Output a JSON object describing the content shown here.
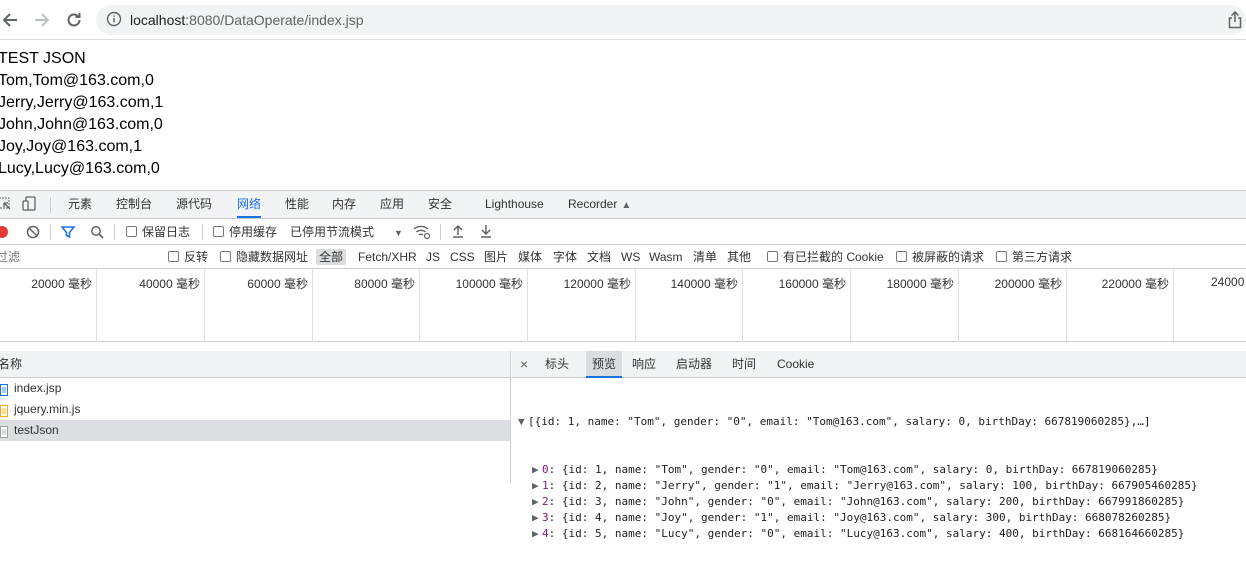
{
  "browser": {
    "url_host": "localhost",
    "url_rest": ":8080/DataOperate/index.jsp"
  },
  "page": {
    "lines": [
      "TEST JSON",
      "Tom,Tom@163.com,0",
      "Jerry,Jerry@163.com,1",
      "John,John@163.com,0",
      "Joy,Joy@163.com,1",
      "Lucy,Lucy@163.com,0"
    ]
  },
  "devtools": {
    "tabs": [
      "元素",
      "控制台",
      "源代码",
      "网络",
      "性能",
      "内存",
      "应用",
      "安全",
      "Lighthouse",
      "Recorder"
    ],
    "active_tab": "网络",
    "toolbar": {
      "preserve_log": "保留日志",
      "disable_cache": "停用缓存",
      "throttle": "已停用节流模式"
    },
    "filter": {
      "placeholder": "过滤",
      "invert": "反转",
      "hide_data_urls": "隐藏数据网址",
      "types": [
        "全部",
        "Fetch/XHR",
        "JS",
        "CSS",
        "图片",
        "媒体",
        "字体",
        "文档",
        "WS",
        "Wasm",
        "清单",
        "其他"
      ],
      "blocked_cookies": "有已拦截的 Cookie",
      "blocked_requests": "被屏蔽的请求",
      "third_party": "第三方请求"
    },
    "timeline": {
      "labels": [
        "20000 毫秒",
        "40000 毫秒",
        "60000 毫秒",
        "80000 毫秒",
        "100000 毫秒",
        "120000 毫秒",
        "140000 毫秒",
        "160000 毫秒",
        "180000 毫秒",
        "200000 毫秒",
        "220000 毫秒",
        "24000"
      ]
    },
    "requests": {
      "header": "名称",
      "items": [
        "index.jsp",
        "jquery.min.js",
        "testJson"
      ],
      "selected": "testJson"
    },
    "detail": {
      "close": "×",
      "tabs": [
        "标头",
        "预览",
        "响应",
        "启动器",
        "时间",
        "Cookie"
      ],
      "active_tab": "预览",
      "json_summary": "[{id: 1, name: \"Tom\", gender: \"0\", email: \"Tom@163.com\", salary: 0, birthDay: 667819060285},…]",
      "json_rows": [
        {
          "index": "0",
          "text": "{id: 1, name: \"Tom\", gender: \"0\", email: \"Tom@163.com\", salary: 0, birthDay: 667819060285}"
        },
        {
          "index": "1",
          "text": "{id: 2, name: \"Jerry\", gender: \"1\", email: \"Jerry@163.com\", salary: 100, birthDay: 667905460285}"
        },
        {
          "index": "2",
          "text": "{id: 3, name: \"John\", gender: \"0\", email: \"John@163.com\", salary: 200, birthDay: 667991860285}"
        },
        {
          "index": "3",
          "text": "{id: 4, name: \"Joy\", gender: \"1\", email: \"Joy@163.com\", salary: 300, birthDay: 668078260285}"
        },
        {
          "index": "4",
          "text": "{id: 5, name: \"Lucy\", gender: \"0\", email: \"Lucy@163.com\", salary: 400, birthDay: 668164660285}"
        }
      ]
    }
  }
}
